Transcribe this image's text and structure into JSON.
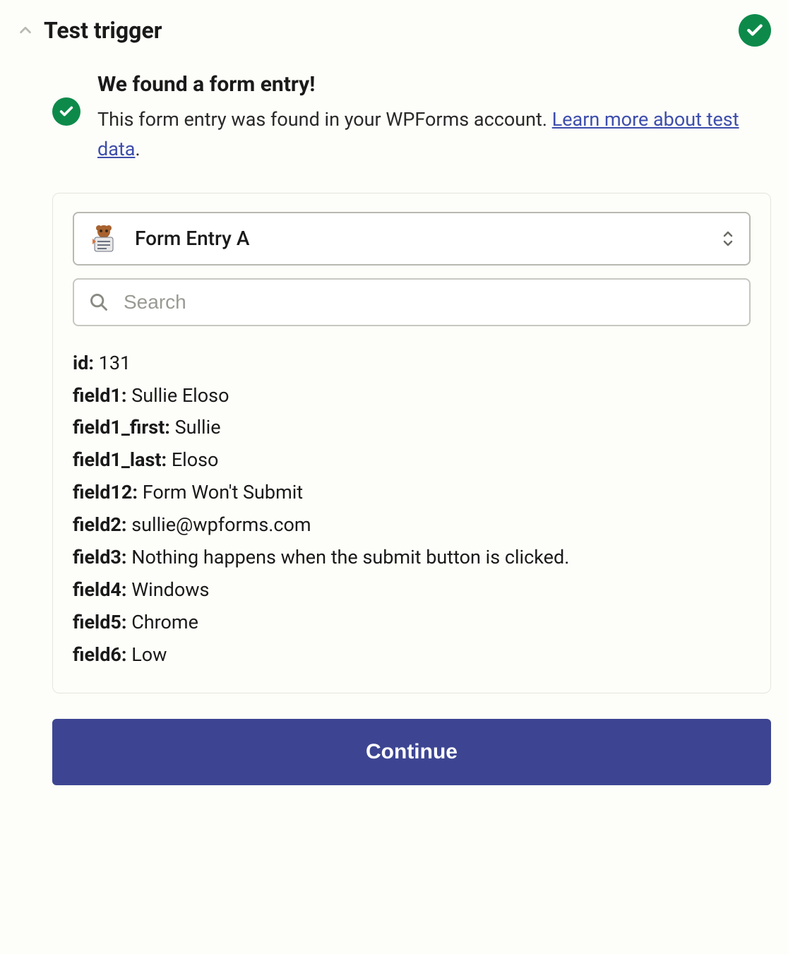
{
  "header": {
    "title": "Test trigger"
  },
  "success": {
    "heading": "We found a form entry!",
    "descPrefix": "This form entry was found in your WPForms account. ",
    "linkText": "Learn more about test data",
    "descSuffix": "."
  },
  "select": {
    "label": "Form Entry A"
  },
  "search": {
    "placeholder": "Search"
  },
  "fields": [
    {
      "key": "id:",
      "val": "131"
    },
    {
      "key": "field1:",
      "val": "Sullie Eloso"
    },
    {
      "key": "field1_first:",
      "val": "Sullie"
    },
    {
      "key": "field1_last:",
      "val": "Eloso"
    },
    {
      "key": "field12:",
      "val": "Form Won't Submit"
    },
    {
      "key": "field2:",
      "val": "sullie@wpforms.com"
    },
    {
      "key": "field3:",
      "val": "Nothing happens when the submit button is clicked."
    },
    {
      "key": "field4:",
      "val": "Windows"
    },
    {
      "key": "field5:",
      "val": "Chrome"
    },
    {
      "key": "field6:",
      "val": "Low"
    }
  ],
  "continue": {
    "label": "Continue"
  }
}
